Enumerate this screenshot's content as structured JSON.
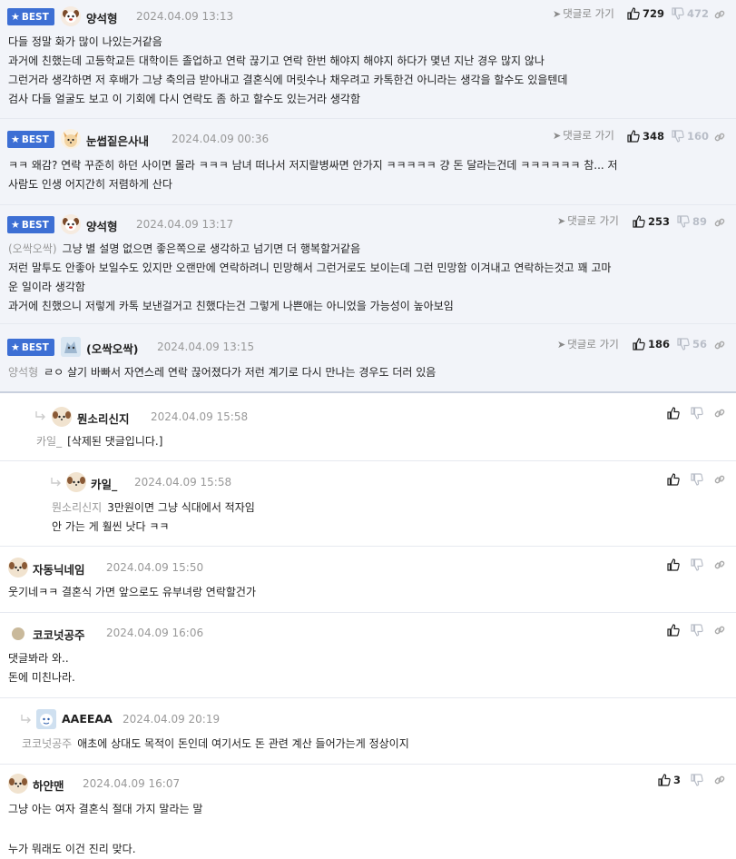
{
  "best_label": "BEST",
  "reply_label": "댓글로 가기",
  "comments": [
    {
      "nick": "양석형",
      "date": "2024.04.09 13:13",
      "up": "729",
      "down": "472",
      "lines": [
        "다들 정말 화가 많이 나있는거같음",
        "과거에 친했는데 고등학교든 대학이든 졸업하고 연락 끊기고 연락 한번 해야지 해야지 하다가 몇년 지난 경우 많지 않나",
        "그런거라 생각하면 저 후배가 그냥 축의금 받아내고 결혼식에 머릿수나 채우려고 카톡한건 아니라는 생각을 할수도 있을텐데",
        "검사 다들 얼굴도 보고 이 기회에 다시 연락도 좀 하고 할수도 있는거라 생각함"
      ]
    },
    {
      "nick": "눈썹짙은사내",
      "date": "2024.04.09 00:36",
      "up": "348",
      "down": "160",
      "lines": [
        "ㅋㅋ 왜감? 연락 꾸준히 하던 사이면 몰라 ㅋㅋㅋ 남녀 떠나서 저지랄병싸면 안가지 ㅋㅋㅋㅋㅋ 걍 돈 달라는건데 ㅋㅋㅋㅋㅋㅋ 참... 저",
        "사람도 인생 어지간히 저렴하게 산다"
      ]
    },
    {
      "nick": "양석형",
      "date": "2024.04.09 13:17",
      "up": "253",
      "down": "89",
      "mention": "(오싹오싹)",
      "lines": [
        "그냥 별 설명 없으면 좋은쪽으로 생각하고 넘기면 더 행복할거같음",
        "저런 말투도 안좋아 보일수도 있지만 오랜만에 연락하려니 민망해서 그런거로도 보이는데 그런 민망함 이겨내고 연락하는것고 꽤 고마",
        "운 일이라 생각함",
        "과거에 친했으니 저렇게 카톡 보낸걸거고 친했다는건 그렇게 나쁜애는 아니었을 가능성이 높아보임"
      ]
    },
    {
      "nick": "(오싹오싹)",
      "date": "2024.04.09 13:15",
      "up": "186",
      "down": "56",
      "mention": "양석형",
      "lines": [
        "ㄹㅇ 살기 바빠서 자연스레 연락 끊어졌다가 저런 계기로 다시 만나는 경우도 더러 있음"
      ]
    },
    {
      "nick": "뭔소리신지",
      "date": "2024.04.09 15:58",
      "mention": "카일_",
      "lines": [
        "[삭제된 댓글입니다.]"
      ]
    },
    {
      "nick": "카일_",
      "date": "2024.04.09 15:58",
      "mention": "뭔소리신지",
      "lines": [
        "3만원이면 그냥 식대에서 적자임",
        "안 가는 게 훨씬 낫다 ㅋㅋ"
      ]
    },
    {
      "nick": "자동닉네임",
      "date": "2024.04.09 15:50",
      "lines": [
        "웃기네ㅋㅋ 결혼식 가면 앞으로도 유부녀랑 연락할건가"
      ]
    },
    {
      "nick": "코코넛공주",
      "date": "2024.04.09 16:06",
      "lines": [
        "댓글봐라 와..",
        "돈에 미친나라."
      ]
    },
    {
      "nick": "AAEEAA",
      "date": "2024.04.09 20:19",
      "mention": "코코넛공주",
      "lines": [
        "애초에 상대도 목적이 돈인데 여기서도 돈 관련 계산 들어가는게 정상이지"
      ]
    },
    {
      "nick": "하얀맨",
      "date": "2024.04.09 16:07",
      "up": "3",
      "lines": [
        "그냥 아는 여자 결혼식 절대 가지 말라는 말",
        "",
        "누가 뭐래도 이건 진리 맞다."
      ]
    }
  ]
}
